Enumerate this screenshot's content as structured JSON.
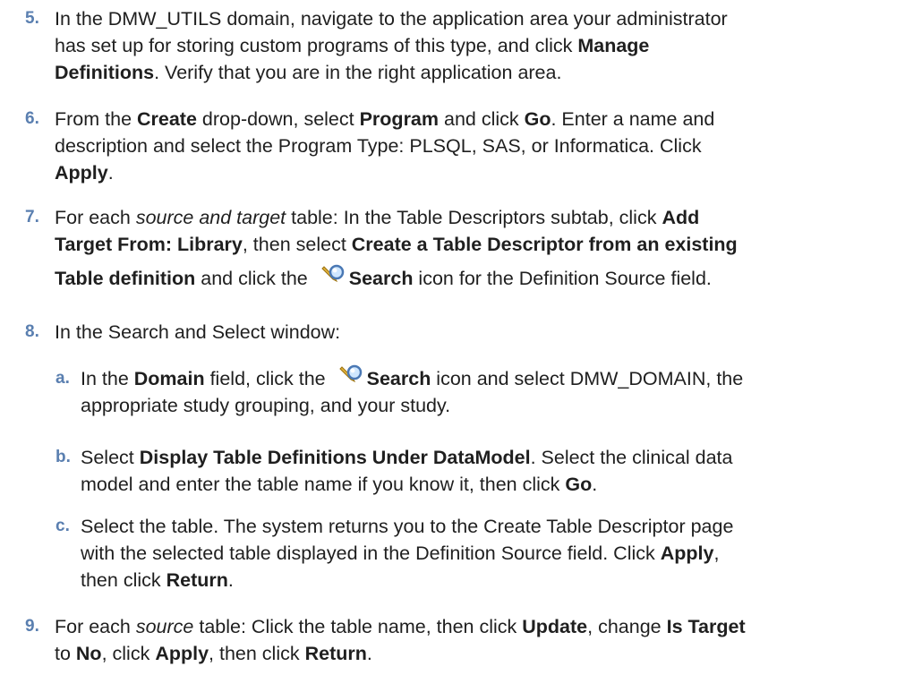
{
  "steps": [
    {
      "num": "5.",
      "line1": "In the DMW_UTILS domain, navigate to the application area your administrator",
      "line2a": "has set up for storing custom programs of this type, and click ",
      "line2b": "Manage",
      "line3a": "Definitions",
      "line3b": ". Verify that you are in the right application area."
    },
    {
      "num": "6.",
      "l1a": "From the ",
      "l1b": "Create",
      "l1c": " drop-down, select ",
      "l1d": "Program",
      "l1e": " and click ",
      "l1f": "Go",
      "l1g": ". Enter a name and",
      "line2": "description and select the Program Type: PLSQL, SAS, or Informatica. Click",
      "l3a": "Apply",
      "l3b": "."
    },
    {
      "num": "7.",
      "l1a": "For each ",
      "l1b": "source and target",
      "l1c": " table: In the Table Descriptors subtab, click ",
      "l1d": "Add",
      "l2a": "Target From: Library",
      "l2b": ", then select ",
      "l2c": "Create a Table Descriptor from an existing",
      "l3a": "Table definition",
      "l3b": " and click the ",
      "l3c": "Search",
      "l3d": " icon for the Definition Source field."
    },
    {
      "num": "8.",
      "line1": "In the Search and Select window:"
    },
    {
      "num": "9.",
      "l1a": "For each ",
      "l1b": "source",
      "l1c": " table: Click the table name, then click ",
      "l1d": "Update",
      "l1e": ", change ",
      "l1f": "Is Target",
      "l2a": "to ",
      "l2b": "No",
      "l2c": ", click ",
      "l2d": "Apply",
      "l2e": ", then click ",
      "l2f": "Return",
      "l2g": "."
    }
  ],
  "substeps": [
    {
      "num": "a.",
      "l1a": "In the ",
      "l1b": "Domain",
      "l1c": " field, click the ",
      "l1d": "Search",
      "l1e": " icon and select DMW_DOMAIN, the",
      "line2": "appropriate study grouping, and your study."
    },
    {
      "num": "b.",
      "l1a": "Select ",
      "l1b": "Display Table Definitions Under DataModel",
      "l1c": ". Select the clinical data",
      "l2a": "model and enter the table name if you know it, then click ",
      "l2b": "Go",
      "l2c": "."
    },
    {
      "num": "c.",
      "line1": "Select the table. The system returns you to the Create Table Descriptor page",
      "line2": "with the selected table displayed in the Definition Source field. Click ",
      "l2b": "Apply",
      "l2c": ",",
      "l3a": "then click ",
      "l3b": "Return",
      "l3c": "."
    }
  ],
  "icons": {
    "search": "magnifier-search-icon",
    "accent_color": "#5a7fb0"
  }
}
